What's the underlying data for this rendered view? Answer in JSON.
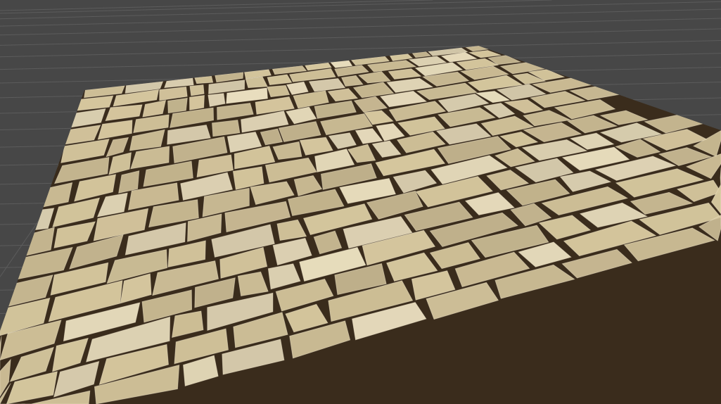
{
  "viewport": {
    "background_color": "#474747",
    "grid_color": "#5c5c5c",
    "stone_color": "#d6c79e",
    "stone_highlight": "#eadfbf",
    "mortar_color": "#3a2c1c"
  }
}
